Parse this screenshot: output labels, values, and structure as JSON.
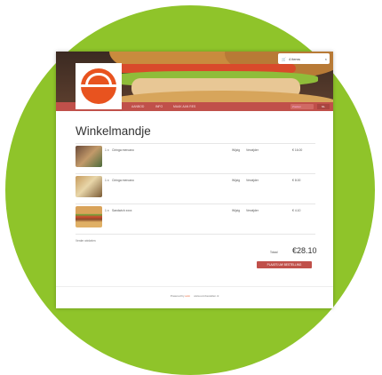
{
  "header": {
    "cart_count_label": "4 items",
    "close": "×"
  },
  "nav": {
    "items": [
      "AANBOD",
      "INFO",
      "MAAK AAN RES"
    ],
    "search_placeholder": "Zoeken",
    "lang": "NL"
  },
  "page": {
    "title": "Winkelmandje"
  },
  "cart": {
    "items": [
      {
        "qty": "1 x",
        "name": "Ciringa mercano",
        "edit": "Wijzig",
        "remove": "Verwijder",
        "price": "€ 16.00"
      },
      {
        "qty": "1 x",
        "name": "Ciringa mercano",
        "edit": "Wijzig",
        "remove": "Verwijder",
        "price": "€ 8.00"
      },
      {
        "qty": "1 x",
        "name": "Sandwich xxxx",
        "edit": "Wijzig",
        "remove": "Verwijder",
        "price": "€ 4.10"
      }
    ],
    "continue_label": "Verder winkelen",
    "total_label": "Totaal",
    "total_value": "€28.10",
    "checkout_label": "PLAATS UW BESTELLING"
  },
  "footer": {
    "powered_prefix": "Powered by",
    "brand": "ucm",
    "site": "www.ucmbestellen.nl"
  },
  "colors": {
    "background_circle": "#8fc42a",
    "accent": "#c0504a",
    "logo": "#e8531f"
  }
}
